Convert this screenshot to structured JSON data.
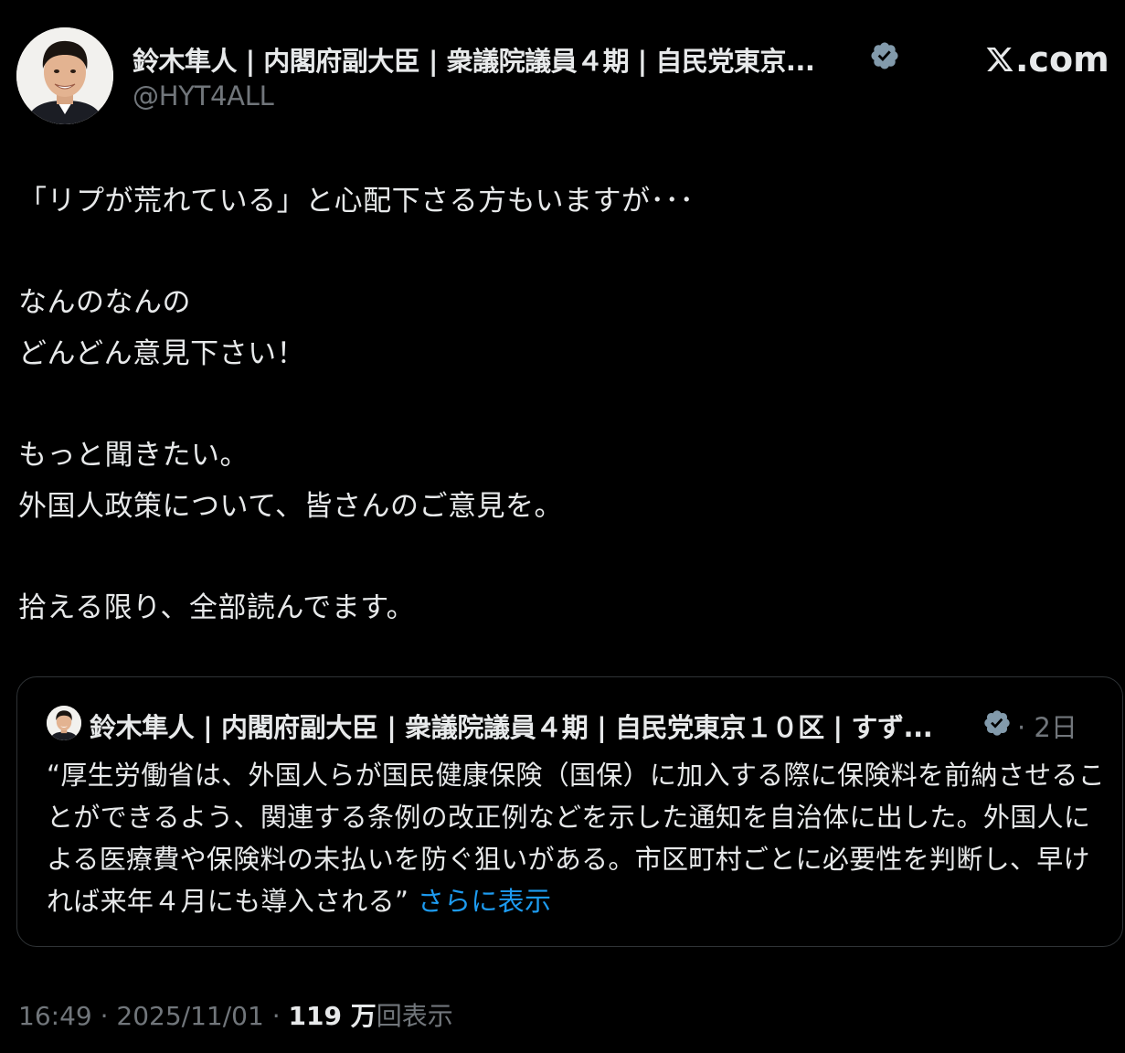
{
  "author": {
    "name": "鈴木隼人 | 内閣府副大臣 | 衆議院議員４期 | 自民党東京...",
    "handle": "@HYT4ALL"
  },
  "brand": {
    "label": ".com"
  },
  "tweet": {
    "line1": "「リプが荒れている」と心配下さる方もいますが･･･",
    "line2": "なんのなんの",
    "line3": "どんどん意見下さい！",
    "line4": "もっと聞きたい。",
    "line5": "外国人政策について、皆さんのご意見を。",
    "line6": "拾える限り、全部読んでます。"
  },
  "quote": {
    "name": "鈴木隼人 | 内閣府副大臣 | 衆議院議員４期 | 自民党東京１０区 | すず...",
    "time": "· 2日",
    "text": "“厚生労働省は、外国人らが国民健康保険（国保）に加入する際に保険料を前納させることができるよう、関連する条例の改正例などを示した通知を自治体に出した。外国人による医療費や保険料の未払いを防ぐ狙いがある。市区町村ごとに必要性を判断し、早ければ来年４月にも導入される”",
    "more": "さらに表示"
  },
  "meta": {
    "time": "16:49",
    "sep1": " · ",
    "date": "2025/11/01",
    "sep2": " · ",
    "views": "119 万",
    "views_label": "回表示"
  },
  "colors": {
    "background": "#000000",
    "text": "#e7e9ea",
    "muted": "#71767b",
    "link": "#1d9bf0",
    "verified": "#829aab",
    "border": "#2f3336"
  },
  "icons": [
    "profile-avatar",
    "verified-badge-icon",
    "x-logo-icon"
  ]
}
